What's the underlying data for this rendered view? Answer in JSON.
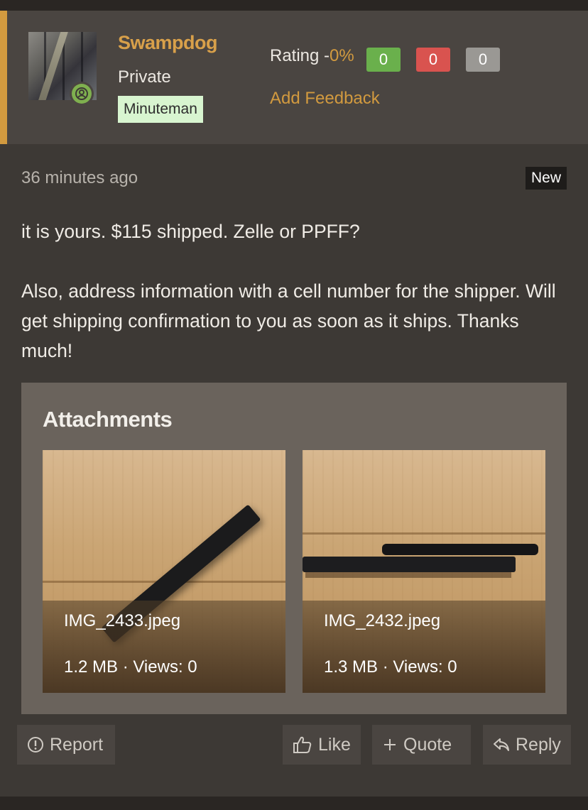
{
  "user": {
    "username": "Swampdog",
    "title": "Private",
    "banner": "Minuteman",
    "avatar_icon": "avatar-image",
    "online_icon": "user-online-icon"
  },
  "rating": {
    "label": "Rating -",
    "percent": "0%",
    "positive": "0",
    "negative": "0",
    "neutral": "0",
    "feedback_link": "Add Feedback",
    "colors": {
      "positive": "#6ab04c",
      "negative": "#d9534f",
      "neutral": "#9a9894",
      "accent": "#d29a3f"
    }
  },
  "post": {
    "time": "36 minutes ago",
    "badge": "New",
    "body_line1": "it is yours. $115 shipped. Zelle or PPFF?",
    "body_line2": "Also, address information with a cell number for the shipper. Will get shipping confirmation to you as soon as it ships. Thanks much!"
  },
  "attachments": {
    "title": "Attachments",
    "items": [
      {
        "name": "IMG_2433.jpeg",
        "meta": "1.2 MB · Views: 0"
      },
      {
        "name": "IMG_2432.jpeg",
        "meta": "1.3 MB · Views: 0"
      }
    ]
  },
  "actions": {
    "report": "Report",
    "like": "Like",
    "quote": "Quote",
    "reply": "Reply",
    "icons": {
      "report": "warning-circle-icon",
      "like": "thumbs-up-icon",
      "quote": "plus-icon",
      "reply": "reply-arrow-icon"
    }
  }
}
